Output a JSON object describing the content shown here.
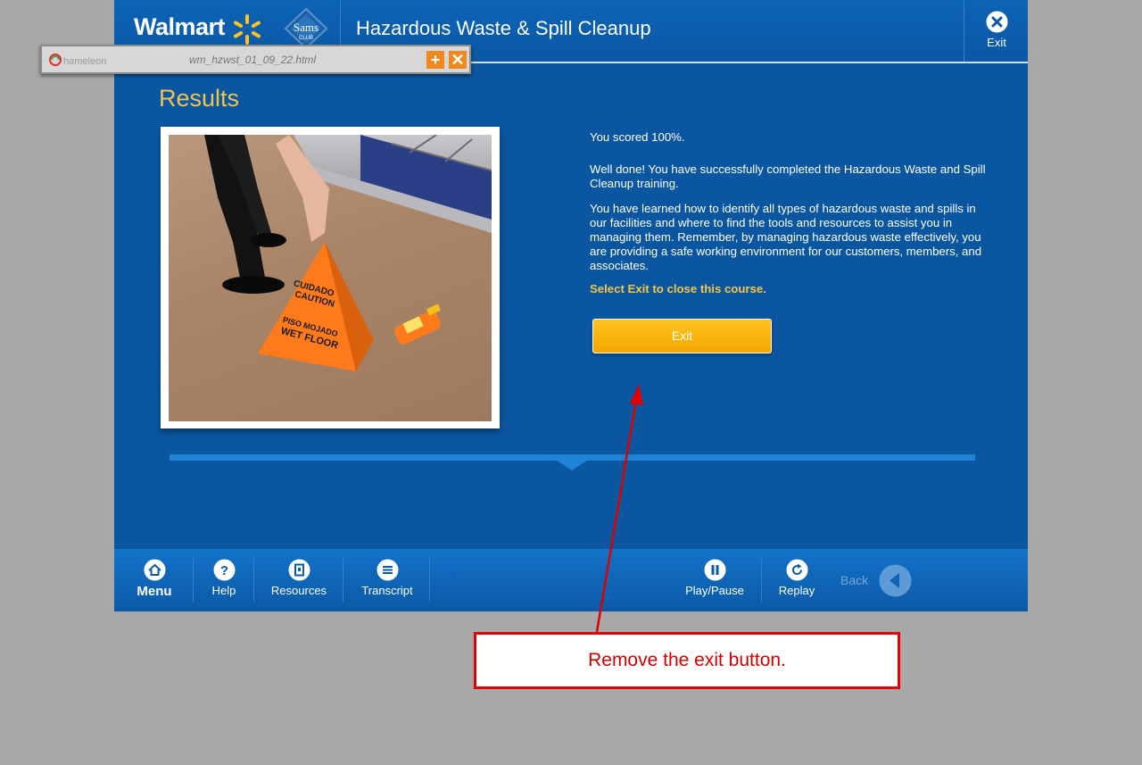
{
  "header": {
    "brand_walmart": "Walmart",
    "brand_sams": "Sams",
    "brand_sams_sub": "CLUB",
    "course_title": "Hazardous Waste & Spill Cleanup",
    "exit_label": "Exit"
  },
  "chameleon_bar": {
    "logo_text": "hameleon",
    "filename": "wm_hzwst_01_09_22.html",
    "plus_icon": "plus-icon",
    "close_icon": "close-icon"
  },
  "main": {
    "section_title": "Results",
    "score_text": "You scored 100%.",
    "paragraph_1": "Well done!  You have successfully completed the Hazardous Waste and Spill Cleanup training.",
    "paragraph_2": "You have learned how to identify all types of hazardous waste and spills in our facilities and where to find the tools and resources to assist you in managing them.  Remember, by managing hazardous waste effectively, you are providing a safe working environment for our customers, members, and associates.",
    "callout": "Select Exit to close this course.",
    "exit_button": "Exit",
    "photo_sign_lines": [
      "CUIDADO",
      "CAUTION",
      "PISO MOJADO",
      "WET FLOOR"
    ]
  },
  "footer": {
    "menu": "Menu",
    "help": "Help",
    "resources": "Resources",
    "transcript": "Transcript",
    "play_pause": "Play/Pause",
    "replay": "Replay",
    "back": "Back"
  },
  "annotation": {
    "text": "Remove the exit button."
  },
  "colors": {
    "course_blue": "#0a56a0",
    "accent_yellow": "#f4c64a",
    "button_orange": "#ffb915",
    "annotation_red": "#e00000"
  }
}
